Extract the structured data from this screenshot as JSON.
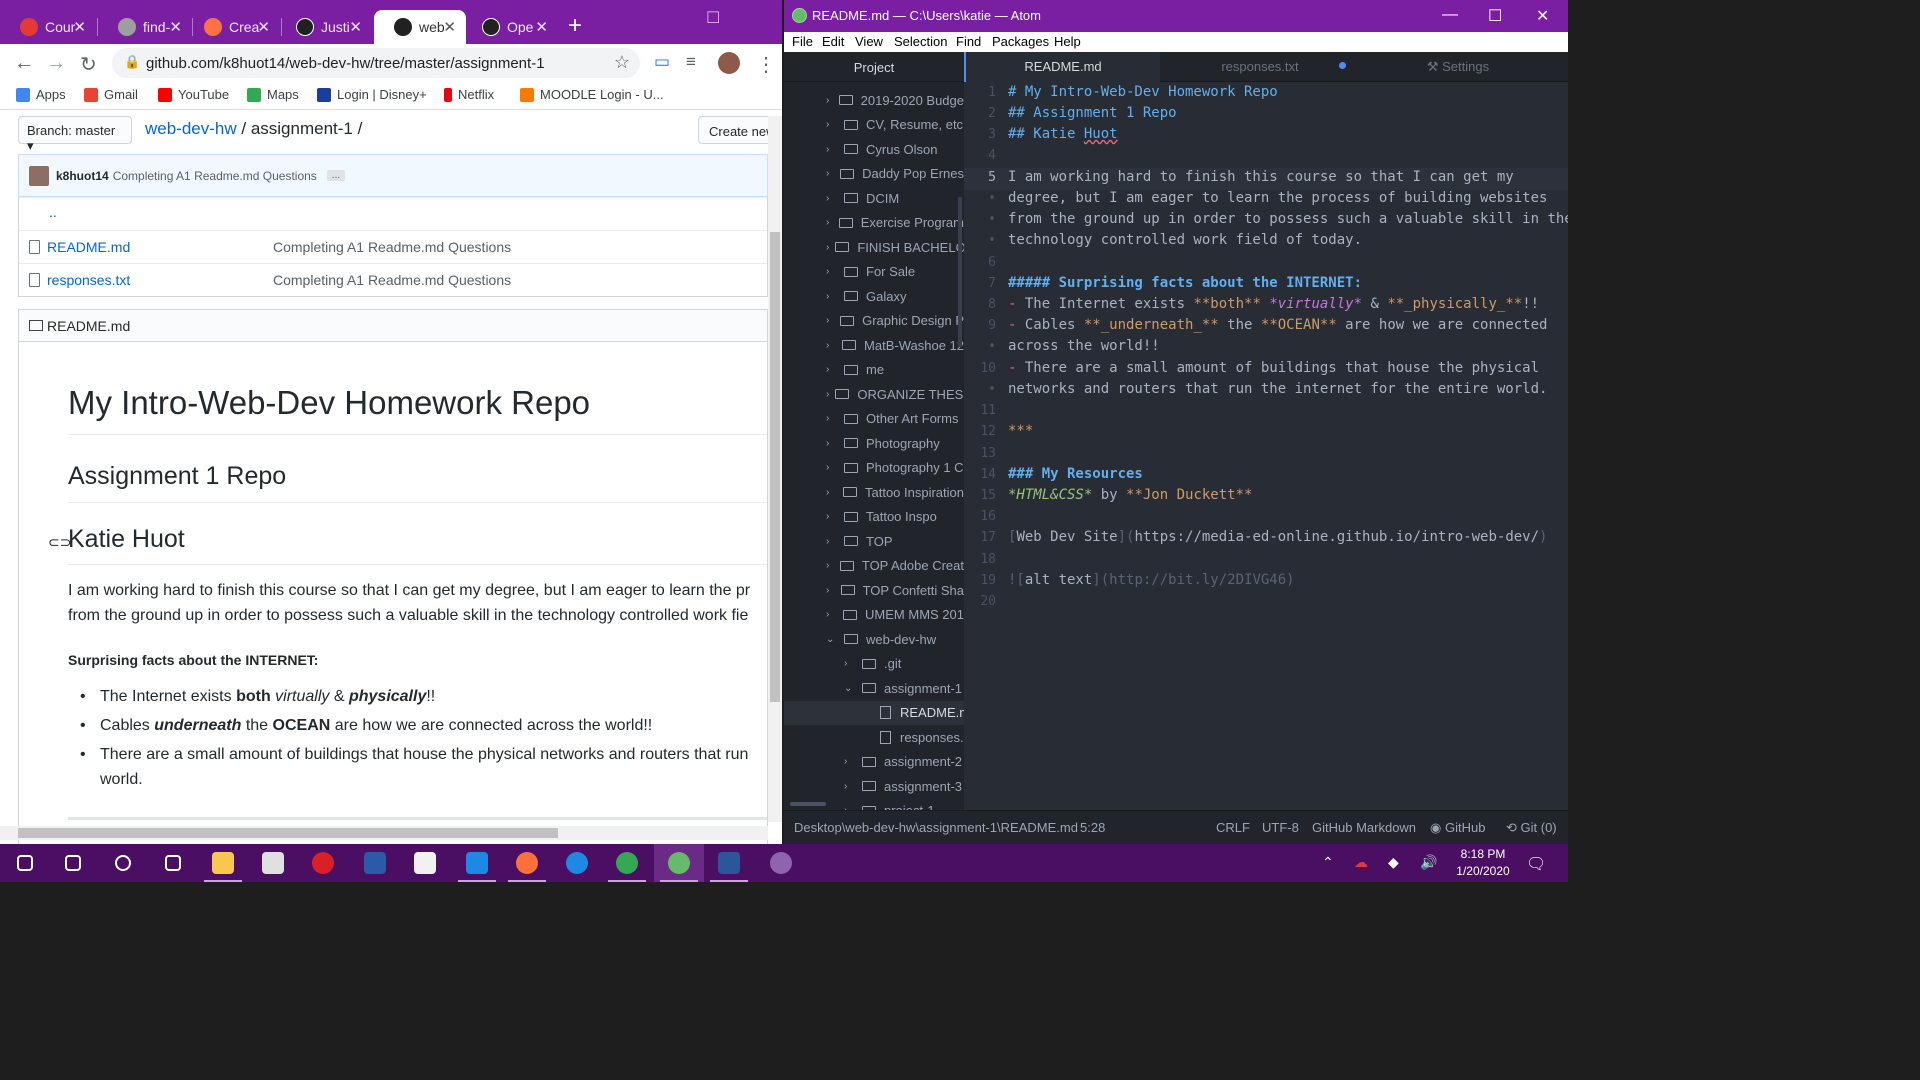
{
  "chrome": {
    "tabs": [
      {
        "label": "Cour",
        "color": "#e53935"
      },
      {
        "label": "find-",
        "color": "#9e9e9e"
      },
      {
        "label": "Crea",
        "color": "#ff7043"
      },
      {
        "label": "Justi",
        "color": "#212121"
      },
      {
        "label": "web",
        "color": "#212121"
      },
      {
        "label": "Ope",
        "color": "#212121"
      }
    ],
    "close_glyph": "✕",
    "new_tab_glyph": "+",
    "url": "github.com/k8huot14/web-dev-hw/tree/master/assignment-1",
    "bookmarks": [
      {
        "label": "Apps",
        "color": "#4285f4"
      },
      {
        "label": "Gmail",
        "color": "#ea4335"
      },
      {
        "label": "YouTube",
        "color": "#ff0000"
      },
      {
        "label": "Maps",
        "color": "#34a853"
      },
      {
        "label": "Login | Disney+",
        "color": "#1a3e9a"
      },
      {
        "label": "Netflix",
        "color": "#e50914"
      },
      {
        "label": "MOODLE Login - U...",
        "color": "#f57c00"
      }
    ]
  },
  "github": {
    "branch_label": "Branch: master ▾",
    "crumb_repo": "web-dev-hw",
    "crumb_sep": " / ",
    "crumb_dir": "assignment-1",
    "crumb_end": " /",
    "create_button": "Create new",
    "commit_user": "k8huot14",
    "commit_message": "Completing A1 Readme.md Questions",
    "commit_more": "...",
    "parent_dir": "..",
    "files": [
      {
        "name": "README.md",
        "message": "Completing A1 Readme.md Questions"
      },
      {
        "name": "responses.txt",
        "message": "Completing A1 Readme.md Questions"
      }
    ],
    "readme_header": "README.md",
    "readme": {
      "h1": "My Intro-Web-Dev Homework Repo",
      "h2a": "Assignment 1 Repo",
      "h2b": "Katie Huot",
      "para1_line1": "I am working hard to finish this course so that I can get my degree, but I am eager to learn the pr",
      "para1_line2": "from the ground up in order to possess such a valuable skill in the technology controlled work fie",
      "h5": "Surprising facts about the INTERNET:",
      "b1": {
        "pre": "The Internet exists ",
        "both": "both",
        "mid1": " ",
        "virtually": "virtually",
        "amp": " & ",
        "physically": "physically",
        "end": "!!"
      },
      "b2": {
        "pre": "Cables ",
        "underneath": "underneath",
        "mid": " the ",
        "ocean": "OCEAN",
        "end": " are how we are connected across the world!!"
      },
      "b3_line1": "There are a small amount of buildings that house the physical networks and routers that run",
      "b3_line2": "world."
    }
  },
  "atom": {
    "title": "README.md — C:\\Users\\katie — Atom",
    "menu": [
      "File",
      "Edit",
      "View",
      "Selection",
      "Find",
      "Packages",
      "Help"
    ],
    "tree_header": "Project",
    "tree": [
      {
        "label": "2019-2020 Budge",
        "type": "folder",
        "depth": 0
      },
      {
        "label": "CV, Resume, etc",
        "type": "folder",
        "depth": 0
      },
      {
        "label": "Cyrus Olson",
        "type": "folder",
        "depth": 0
      },
      {
        "label": "Daddy Pop Ernes",
        "type": "folder",
        "depth": 0
      },
      {
        "label": "DCIM",
        "type": "folder",
        "depth": 0
      },
      {
        "label": "Exercise Program",
        "type": "folder",
        "depth": 0
      },
      {
        "label": "FINISH BACHELO",
        "type": "folder",
        "depth": 0
      },
      {
        "label": "For Sale",
        "type": "folder",
        "depth": 0
      },
      {
        "label": "Galaxy",
        "type": "folder",
        "depth": 0
      },
      {
        "label": "Graphic Design P",
        "type": "folder",
        "depth": 0
      },
      {
        "label": "MatB-Washoe 12",
        "type": "folder",
        "depth": 0
      },
      {
        "label": "me",
        "type": "folder",
        "depth": 0
      },
      {
        "label": "ORGANIZE THESI",
        "type": "folder",
        "depth": 0
      },
      {
        "label": "Other Art Forms",
        "type": "folder",
        "depth": 0
      },
      {
        "label": "Photography",
        "type": "folder",
        "depth": 0
      },
      {
        "label": "Photography 1 C",
        "type": "folder",
        "depth": 0
      },
      {
        "label": "Tattoo Inspiration",
        "type": "folder",
        "depth": 0
      },
      {
        "label": "Tattoo Inspo",
        "type": "folder",
        "depth": 0
      },
      {
        "label": "TOP",
        "type": "folder",
        "depth": 0
      },
      {
        "label": "TOP Adobe Creat",
        "type": "folder",
        "depth": 0
      },
      {
        "label": "TOP Confetti Sha",
        "type": "folder",
        "depth": 0
      },
      {
        "label": "UMEM MMS 201",
        "type": "folder",
        "depth": 0
      },
      {
        "label": "web-dev-hw",
        "type": "folder-open",
        "depth": 0
      },
      {
        "label": ".git",
        "type": "folder",
        "depth": 1
      },
      {
        "label": "assignment-1",
        "type": "folder-open",
        "depth": 1
      },
      {
        "label": "README.m",
        "type": "book",
        "depth": 2
      },
      {
        "label": "responses.",
        "type": "file",
        "depth": 2
      },
      {
        "label": "assignment-2",
        "type": "folder",
        "depth": 1
      },
      {
        "label": "assignment-3",
        "type": "folder",
        "depth": 1
      },
      {
        "label": "project-1",
        "type": "folder",
        "depth": 1
      }
    ],
    "tabs": [
      {
        "label": "README.md"
      },
      {
        "label": "responses.txt"
      },
      {
        "label": "Settings"
      }
    ],
    "lines": [
      "1",
      "2",
      "3",
      "4",
      "5",
      "•",
      "•",
      "•",
      "6",
      "7",
      "8",
      "9",
      "•",
      "10",
      "•",
      "11",
      "12",
      "13",
      "14",
      "15",
      "16",
      "17",
      "18",
      "19",
      "20"
    ],
    "code": {
      "l1": "# My Intro-Web-Dev Homework Repo",
      "l2": "## Assignment 1 Repo",
      "l3a": "## Katie ",
      "l3b": "Huot",
      "l5a": "I am working hard to finish this course so that I can get my",
      "l5b": "degree, but I am eager to learn the process of building websites",
      "l5c": "from the ground up in order to possess such a valuable skill in the",
      "l5d": "technology controlled work field of today.",
      "l7": "##### Surprising facts about the INTERNET:",
      "l8_dash": "- ",
      "l8_pre": "The Internet exists ",
      "l8_both": "**both**",
      "l8_virt": "*virtually*",
      "l8_amp": " & ",
      "l8_phys": "**_physically_**",
      "l8_end": "!!",
      "l9_dash": "- ",
      "l9_pre": "Cables ",
      "l9_under": "**_underneath_**",
      "l9_the": " the ",
      "l9_ocean": "**OCEAN**",
      "l9_end": " are how we are connected",
      "l9b": "across the world!!",
      "l10_dash": "- ",
      "l10a": "There are a small amount of buildings that house the physical",
      "l10b": "networks and routers that run the internet for the entire world.",
      "l12": "***",
      "l14": "### My Resources",
      "l15a": "*HTML&CSS*",
      "l15b": " by ",
      "l15c": "**Jon Duckett**",
      "l17a": "[",
      "l17b": "Web Dev Site",
      "l17c": "](",
      "l17d": "https://media-ed-online.github.io/intro-web-dev/",
      "l17e": ")",
      "l19a": "![",
      "l19b": "alt text",
      "l19c": "](",
      "l19d": "http://bit.ly/2DIVG46",
      "l19e": ")"
    },
    "status": {
      "path": "Desktop\\web-dev-hw\\assignment-1\\README.md",
      "cursor": "5:28",
      "line_ending": "CRLF",
      "encoding": "UTF-8",
      "grammar": "GitHub Markdown",
      "github": "GitHub",
      "git": "Git (0)"
    }
  },
  "taskbar": {
    "apps": [
      {
        "name": "start",
        "color": "#ffffff"
      },
      {
        "name": "search",
        "color": "#ffffff"
      },
      {
        "name": "cortana",
        "color": "#ffffff"
      },
      {
        "name": "task-view",
        "color": "#ffffff"
      },
      {
        "name": "file-explorer",
        "color": "#f9c74f"
      },
      {
        "name": "mail",
        "color": "#e0e0e0"
      },
      {
        "name": "creative-cloud",
        "color": "#da1f26"
      },
      {
        "name": "powershell",
        "color": "#2b5aa8"
      },
      {
        "name": "store",
        "color": "#f1f1f1"
      },
      {
        "name": "app-window",
        "color": "#1e88e5"
      },
      {
        "name": "firefox",
        "color": "#ff7139"
      },
      {
        "name": "edge",
        "color": "#1e88e5"
      },
      {
        "name": "chrome",
        "color": "#34a853"
      },
      {
        "name": "atom",
        "color": "#66bb6a"
      },
      {
        "name": "word",
        "color": "#2b579a"
      },
      {
        "name": "github-desktop",
        "color": "#8e63b0"
      }
    ],
    "time": "8:18 PM",
    "date": "1/20/2020"
  }
}
